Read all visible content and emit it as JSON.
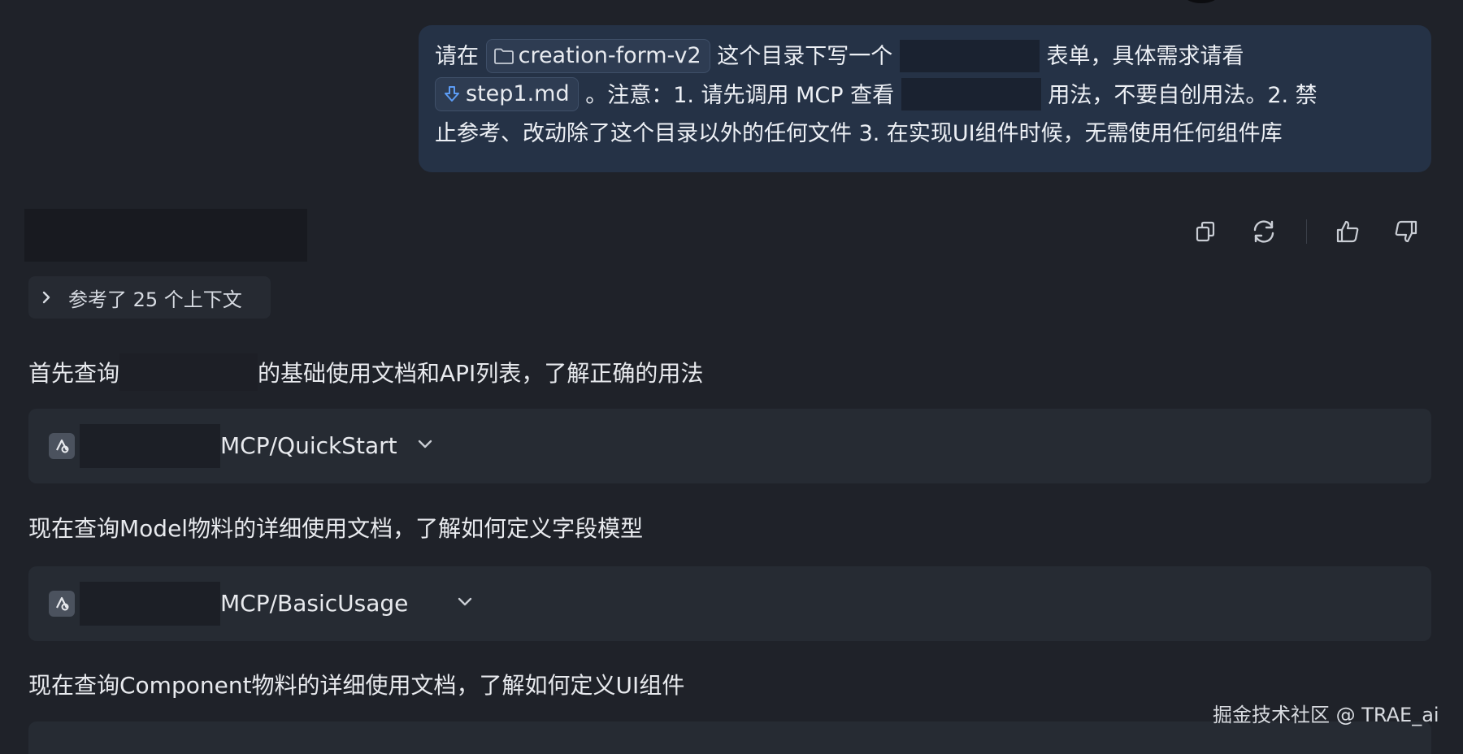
{
  "user_message": {
    "line1": {
      "prefix": "请在",
      "folder_chip": "creation-form-v2",
      "middle": "这个目录下写一个",
      "suffix": "表单，具体需求请看"
    },
    "line2": {
      "file_chip": "step1.md",
      "middle": "。注意：1. 请先调用 MCP 查看",
      "suffix": "用法，不要自创用法。2. 禁"
    },
    "line3": "止参考、改动除了这个目录以外的任何文件 3. 在实现UI组件时候，无需使用任何组件库"
  },
  "actions": {
    "icons": [
      "copy-icon",
      "refresh-icon",
      "thumbs-up-icon",
      "thumbs-down-icon"
    ]
  },
  "context": {
    "label": "参考了 25 个上下文"
  },
  "messages": [
    {
      "before": "首先查询",
      "after": "的基础使用文档和API列表，了解正确的用法"
    },
    {
      "text": "现在查询Model物料的详细使用文档，了解如何定义字段模型"
    },
    {
      "text": "现在查询Component物料的详细使用文档，了解如何定义UI组件"
    }
  ],
  "tool_calls": [
    {
      "name": "MCP/QuickStart",
      "icon": "mcp-tool-icon"
    },
    {
      "name": "MCP/BasicUsage",
      "icon": "mcp-tool-icon"
    }
  ],
  "watermark": "掘金技术社区 @ TRAE_ai",
  "colors": {
    "background": "#1f2229",
    "user_bubble": "#253246",
    "card": "#262b33",
    "file_icon_accent": "#5c9cf5"
  }
}
